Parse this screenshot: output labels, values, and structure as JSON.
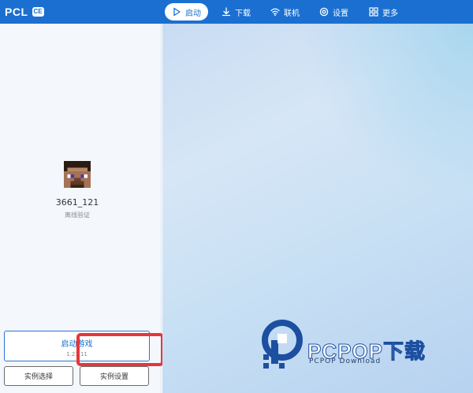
{
  "app": {
    "name": "PCL",
    "badge": "CE"
  },
  "nav": {
    "items": [
      {
        "label": "启动",
        "icon": "play-icon",
        "active": true
      },
      {
        "label": "下载",
        "icon": "download-icon",
        "active": false
      },
      {
        "label": "联机",
        "icon": "wifi-icon",
        "active": false
      },
      {
        "label": "设置",
        "icon": "gear-icon",
        "active": false
      },
      {
        "label": "更多",
        "icon": "grid-icon",
        "active": false
      }
    ]
  },
  "account": {
    "username": "3661_121",
    "auth_type": "离线验证"
  },
  "launch": {
    "label": "启动游戏",
    "version": "1.21.11"
  },
  "instance": {
    "select_label": "实例选择",
    "settings_label": "实例设置"
  },
  "watermark": {
    "brand": "PCPOP下载",
    "subtitle": "PCPOP Download"
  },
  "colors": {
    "accent": "#1a6fd1",
    "highlight": "#e8343b"
  }
}
